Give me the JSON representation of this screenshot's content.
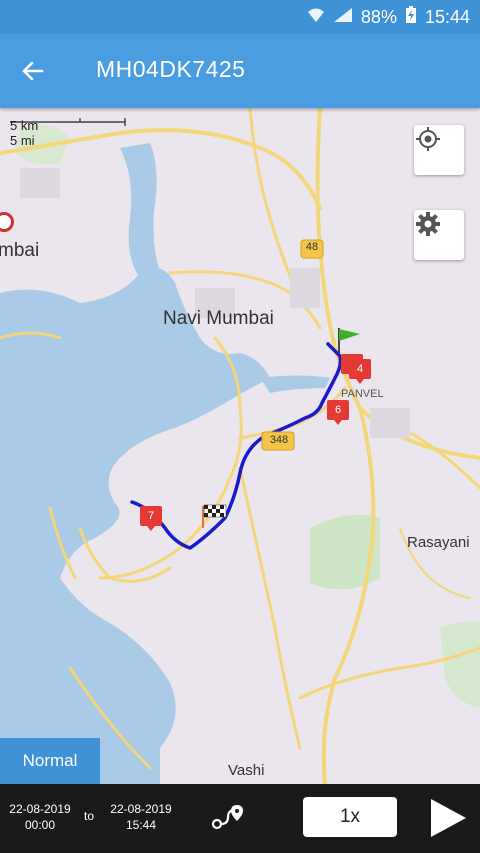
{
  "status_bar": {
    "battery": "88%",
    "time": "15:44"
  },
  "app_bar": {
    "title": "MH04DK7425"
  },
  "map": {
    "scale_km": "5 km",
    "scale_mi": "5 mi",
    "labels": {
      "navi_mumbai": "Navi Mumbai",
      "mumbai_partial": "mbai",
      "panvel": "PANVEL",
      "rasayani": "Rasayani",
      "vashi": "Vashi",
      "road_48": "48",
      "road_348": "348"
    },
    "markers": [
      "4",
      "6",
      "7"
    ]
  },
  "mode_button": {
    "label": "Normal"
  },
  "bottom_bar": {
    "from_date": "22-08-2019",
    "from_time": "00:00",
    "to_label": "to",
    "to_date": "22-08-2019",
    "to_time": "15:44",
    "speed": "1x"
  },
  "colors": {
    "accent": "#4a9de0",
    "route": "#1a1acc",
    "marker": "#e53935",
    "water": "#a9cbe8"
  }
}
